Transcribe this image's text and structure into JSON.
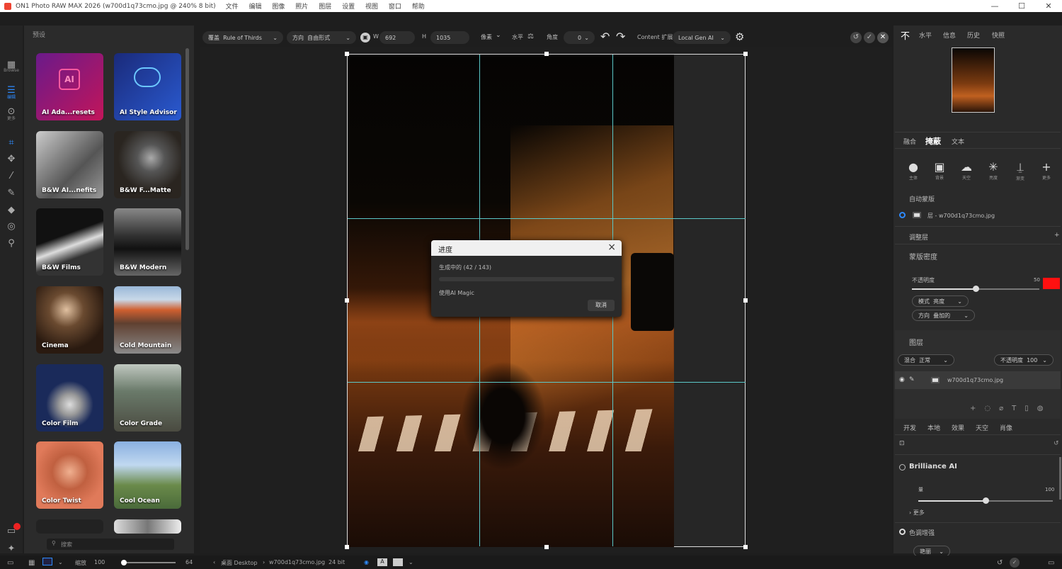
{
  "titlebar": {
    "title": "ON1 Photo RAW MAX 2026 (w700d1q73cmo.jpg @ 240% 8 bit)",
    "menus": [
      "文件",
      "编辑",
      "图像",
      "照片",
      "图层",
      "设置",
      "视图",
      "窗口",
      "帮助"
    ],
    "controls": [
      "—",
      "☐",
      "✕"
    ]
  },
  "leftbar": {
    "tools": [
      {
        "icon": "grid-icon",
        "label": "Browse"
      },
      {
        "icon": "sliders-icon",
        "label": "编辑"
      },
      {
        "icon": "more-icon",
        "label": "更多"
      },
      {
        "icon": "crop-icon",
        "label": ""
      },
      {
        "icon": "move-icon",
        "label": ""
      },
      {
        "icon": "wand-icon",
        "label": ""
      },
      {
        "icon": "brush-icon",
        "label": ""
      },
      {
        "icon": "eraser-icon",
        "label": ""
      },
      {
        "icon": "clone-icon",
        "label": ""
      },
      {
        "icon": "zoom-icon",
        "label": ""
      }
    ]
  },
  "browser": {
    "title": "预设",
    "presets": [
      "AI Ada...resets",
      "AI Style Advisor",
      "B&W AI...nefits",
      "B&W F...Matte",
      "B&W Films",
      "B&W Modern",
      "Cinema",
      "Cold Mountain",
      "Color Film",
      "Color Grade",
      "Color Twist",
      "Cool Ocean"
    ],
    "search_placeholder": "搜索"
  },
  "toolbar": {
    "overlay_label": "覆盖",
    "overlay_value": "Rule of Thirds",
    "aspect_label": "方向",
    "aspect_value": "自由形式",
    "w_label": "W",
    "w_value": "692",
    "h_label": "H",
    "h_value": "1035",
    "unit_value": "像素",
    "level_label": "水平",
    "angle_label": "角度",
    "angle_value": "0",
    "content_aware": "Content 扩展",
    "fill_value": "Local Gen AI"
  },
  "dialog": {
    "title": "进度",
    "progress_text": "生成中的 (42 / 143)",
    "progress": 0,
    "status": "使用AI Magic",
    "cancel": "取消"
  },
  "rightpanel": {
    "tabs": [
      "不",
      "水平",
      "信息",
      "历史",
      "快照"
    ],
    "subtabs": [
      "融合",
      "掩蔽",
      "文本"
    ],
    "mask_tools": [
      {
        "icon": "person-icon",
        "label": "主体"
      },
      {
        "icon": "portrait-icon",
        "label": "背景"
      },
      {
        "icon": "weather-icon",
        "label": "天空"
      },
      {
        "icon": "light-icon",
        "label": "亮度"
      },
      {
        "icon": "gradient-icon",
        "label": "渐变"
      },
      {
        "icon": "add-icon",
        "label": "更多"
      }
    ],
    "mask_heading": "自动蒙版",
    "mask_file": "层 - w700d1q73cmo.jpg",
    "adjust_layer": "调整层",
    "properties": "蒙版密度",
    "opacity_label": "不透明度",
    "opacity_value": "50",
    "opacity": 0.5,
    "mode_label": "模式",
    "mode_value": "亮度",
    "blend_label": "方向",
    "blend_value": "叠加的",
    "layers_title": "图层",
    "blend_mode_label": "混合",
    "blend_mode_value": "正常",
    "layer_opacity_label": "不透明度",
    "layer_opacity_value": "100",
    "layer_name": "w700d1q73cmo.jpg",
    "edit_tabs": [
      "开发",
      "本地",
      "效果",
      "天空",
      "肖像"
    ],
    "brilliance_title": "Brilliance AI",
    "brilliance_slider_label": "量",
    "brilliance_value": "100",
    "brilliance_level": 0.5,
    "more_label": "更多",
    "tone_title": "色调增强",
    "tone_value": "艳丽"
  },
  "bottombar": {
    "zoom_label": "缩放",
    "zoom_value": "100",
    "thumb_value": "64",
    "path": "桌面 Desktop",
    "file": "w700d1q73cmo.jpg",
    "fileinfo": "24 bit"
  },
  "accent_color": "#2e8bff",
  "swatch_color": "#ff1010"
}
